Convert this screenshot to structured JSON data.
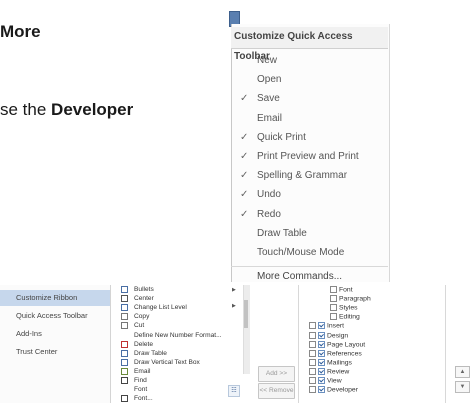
{
  "document": {
    "line1_bold": "More",
    "line2_prefix": "se the ",
    "line2_bold": "Developer"
  },
  "qat_menu": {
    "header": "Customize Quick Access Toolbar",
    "items": [
      {
        "label": "New",
        "checked": false
      },
      {
        "label": "Open",
        "checked": false
      },
      {
        "label": "Save",
        "checked": true
      },
      {
        "label": "Email",
        "checked": false
      },
      {
        "label": "Quick Print",
        "checked": true
      },
      {
        "label": "Print Preview and Print",
        "checked": true
      },
      {
        "label": "Spelling & Grammar",
        "checked": true
      },
      {
        "label": "Undo",
        "checked": true
      },
      {
        "label": "Redo",
        "checked": true
      },
      {
        "label": "Draw Table",
        "checked": false
      },
      {
        "label": "Touch/Mouse Mode",
        "checked": false
      }
    ],
    "more_commands": "More Commands...",
    "check_glyph": "✓"
  },
  "options_nav": {
    "items": [
      {
        "label": "Customize Ribbon",
        "selected": true
      },
      {
        "label": "Quick Access Toolbar",
        "selected": false
      },
      {
        "label": "Add-Ins",
        "selected": false
      },
      {
        "label": "Trust Center",
        "selected": false
      }
    ]
  },
  "commands": {
    "items": [
      {
        "label": "Bullets",
        "icon": "bullets-icon",
        "submenu": true
      },
      {
        "label": "Center",
        "icon": "center-icon",
        "submenu": false
      },
      {
        "label": "Change List Level",
        "icon": "list-level-icon",
        "submenu": true
      },
      {
        "label": "Copy",
        "icon": "copy-icon",
        "submenu": false
      },
      {
        "label": "Cut",
        "icon": "cut-icon",
        "submenu": false
      },
      {
        "label": "Define New Number Format...",
        "icon": "",
        "submenu": false
      },
      {
        "label": "Delete",
        "icon": "delete-icon",
        "submenu": false
      },
      {
        "label": "Draw Table",
        "icon": "draw-table-icon",
        "submenu": false
      },
      {
        "label": "Draw Vertical Text Box",
        "icon": "vertical-text-box-icon",
        "submenu": false
      },
      {
        "label": "Email",
        "icon": "email-icon",
        "submenu": false
      },
      {
        "label": "Find",
        "icon": "find-icon",
        "submenu": false
      },
      {
        "label": "Font",
        "icon": "",
        "submenu": false
      },
      {
        "label": "Font...",
        "icon": "font-dialog-icon",
        "submenu": false
      }
    ]
  },
  "buttons": {
    "add": "Add >>",
    "remove": "<< Remove"
  },
  "ribbon_tree": {
    "items": [
      {
        "label": "Font",
        "level": 2,
        "checkbox": false
      },
      {
        "label": "Paragraph",
        "level": 2,
        "checkbox": false
      },
      {
        "label": "Styles",
        "level": 2,
        "checkbox": false
      },
      {
        "label": "Editing",
        "level": 2,
        "checkbox": false
      },
      {
        "label": "Insert",
        "level": 0,
        "checkbox": true
      },
      {
        "label": "Design",
        "level": 0,
        "checkbox": true
      },
      {
        "label": "Page Layout",
        "level": 0,
        "checkbox": true
      },
      {
        "label": "References",
        "level": 0,
        "checkbox": true
      },
      {
        "label": "Mailings",
        "level": 0,
        "checkbox": true
      },
      {
        "label": "Review",
        "level": 0,
        "checkbox": true
      },
      {
        "label": "View",
        "level": 0,
        "checkbox": true
      },
      {
        "label": "Developer",
        "level": 0,
        "checkbox": true
      }
    ]
  },
  "move_buttons": {
    "up": "▲",
    "down": "▼"
  }
}
